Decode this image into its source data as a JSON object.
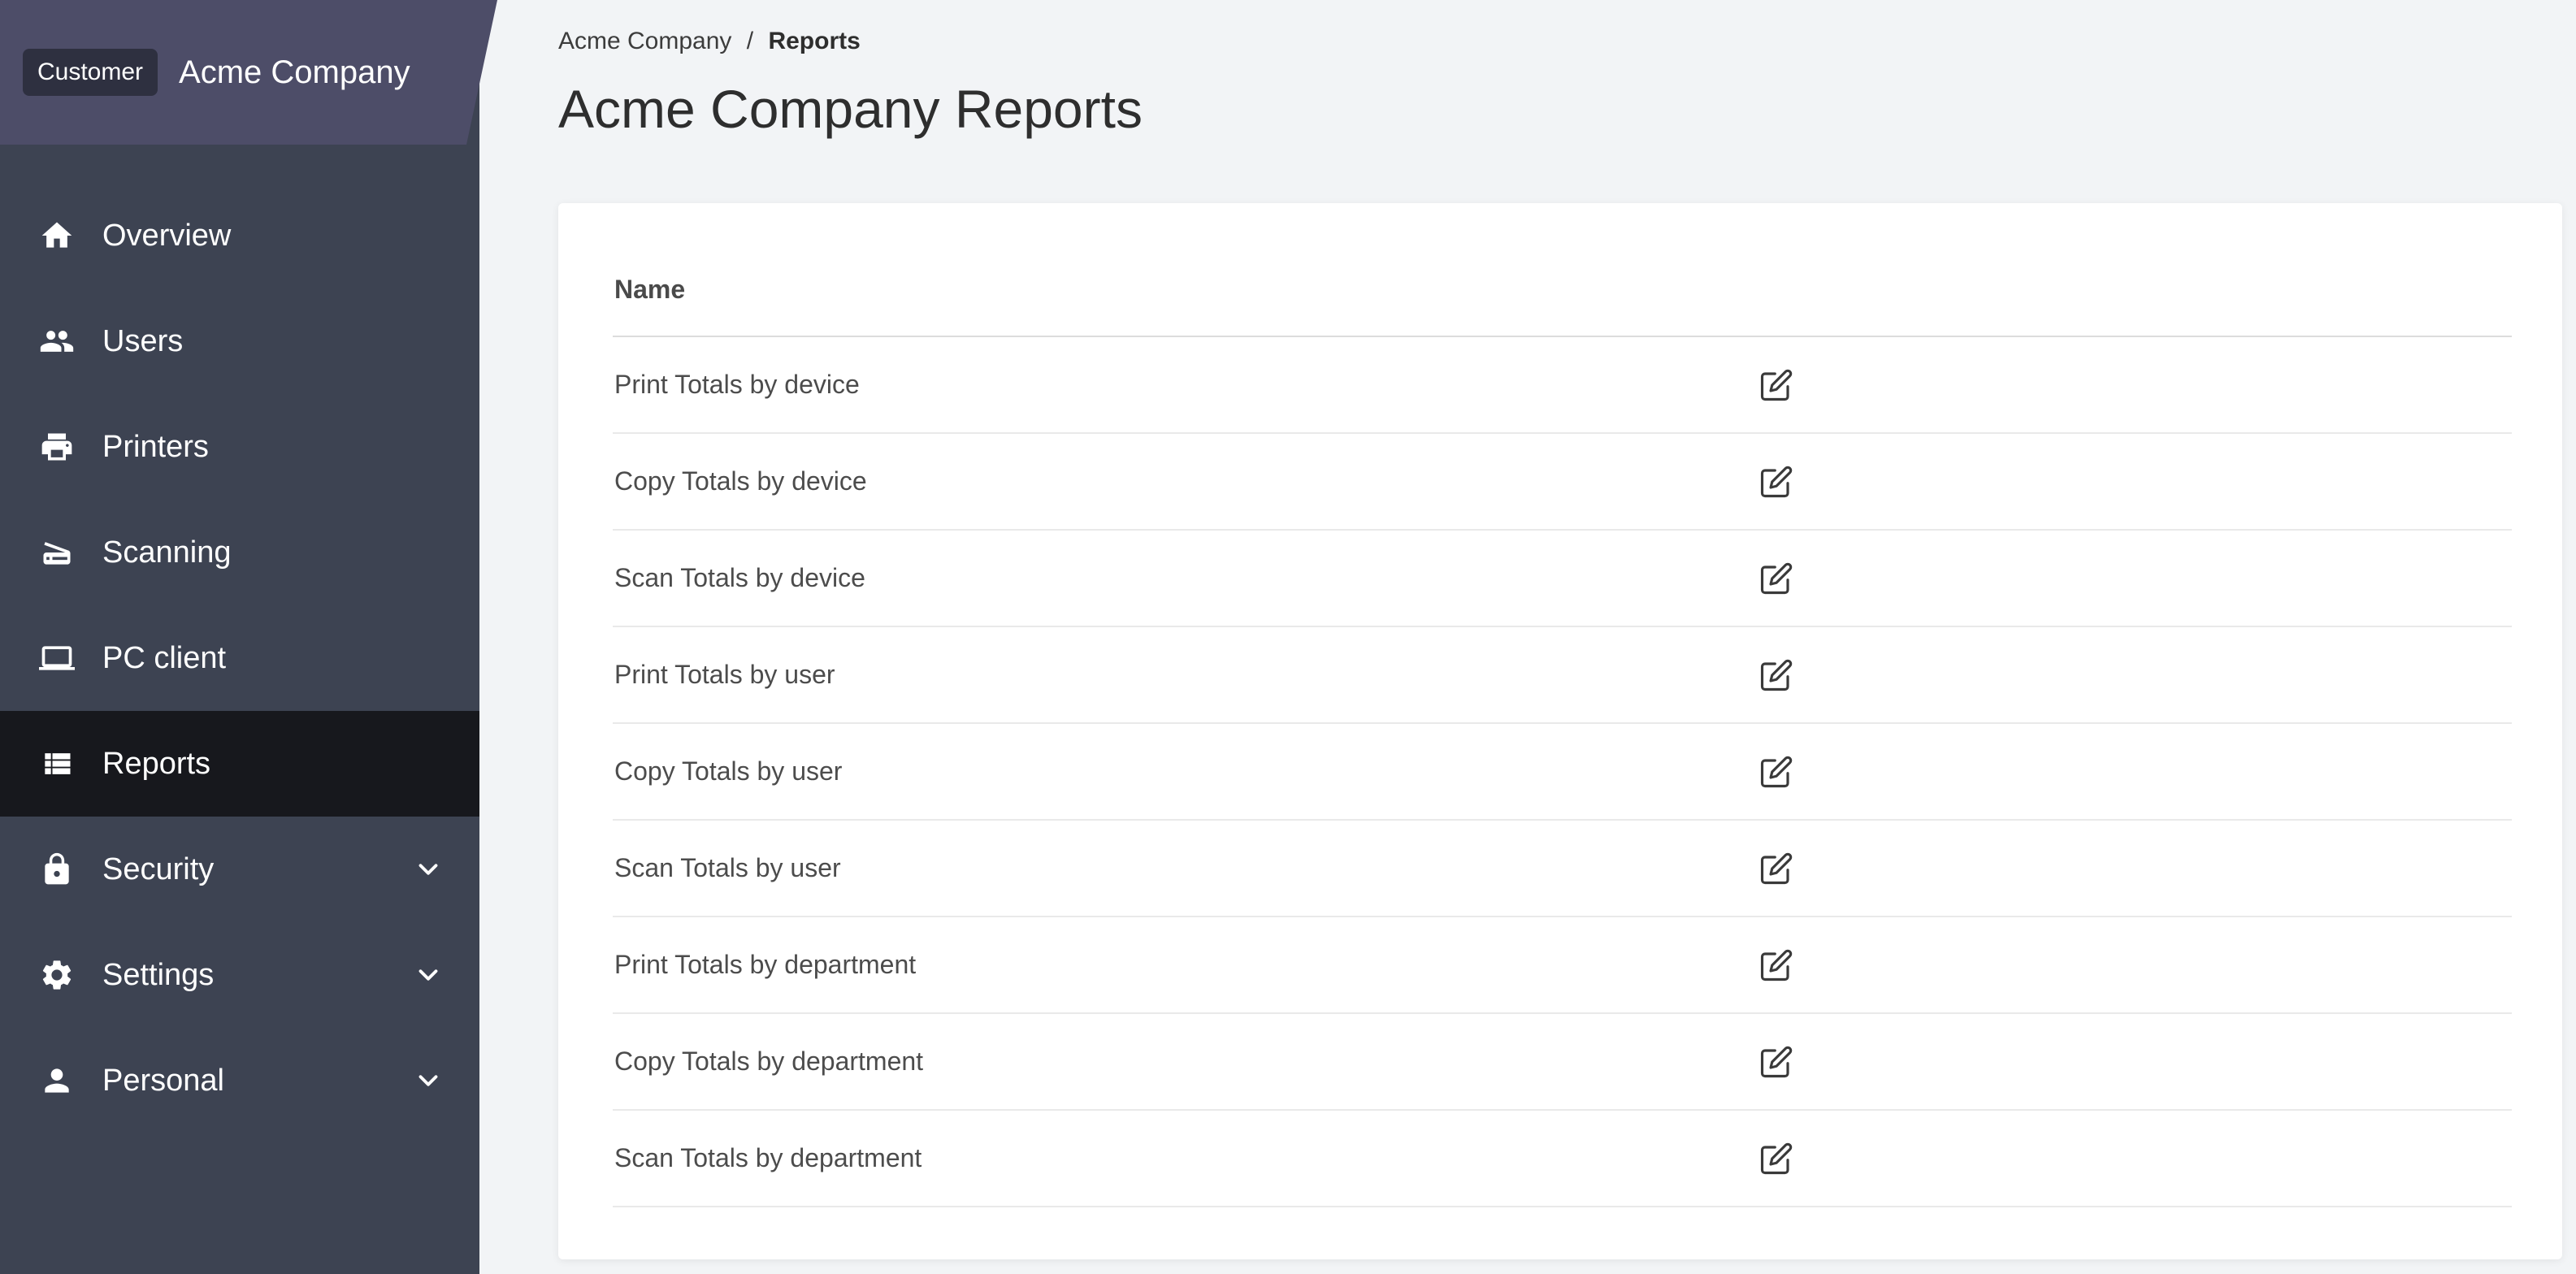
{
  "sidebar": {
    "customer_badge": "Customer",
    "customer_name": "Acme Company",
    "items": [
      {
        "label": "Overview",
        "icon": "home-icon",
        "active": false,
        "expandable": false
      },
      {
        "label": "Users",
        "icon": "users-icon",
        "active": false,
        "expandable": false
      },
      {
        "label": "Printers",
        "icon": "printer-icon",
        "active": false,
        "expandable": false
      },
      {
        "label": "Scanning",
        "icon": "scanner-icon",
        "active": false,
        "expandable": false
      },
      {
        "label": "PC client",
        "icon": "monitor-icon",
        "active": false,
        "expandable": false
      },
      {
        "label": "Reports",
        "icon": "table-icon",
        "active": true,
        "expandable": false
      },
      {
        "label": "Security",
        "icon": "lock-icon",
        "active": false,
        "expandable": true
      },
      {
        "label": "Settings",
        "icon": "gear-icon",
        "active": false,
        "expandable": true
      },
      {
        "label": "Personal",
        "icon": "person-icon",
        "active": false,
        "expandable": true
      }
    ]
  },
  "breadcrumb": {
    "parent": "Acme Company",
    "separator": "/",
    "current": "Reports"
  },
  "page": {
    "title": "Acme Company Reports"
  },
  "table": {
    "name_header": "Name",
    "action_icon": "edit-icon",
    "rows": [
      "Print Totals by device",
      "Copy Totals by device",
      "Scan Totals by device",
      "Print Totals by user",
      "Copy Totals by user",
      "Scan Totals by user",
      "Print Totals by department",
      "Copy Totals by department",
      "Scan Totals by department"
    ]
  },
  "colors": {
    "sidebar_bg": "#3d4352",
    "sidebar_header_bg": "#4d4d68",
    "active_item_bg": "#17181d",
    "badge_bg": "#2e3040",
    "main_bg": "#f2f4f6",
    "card_bg": "#ffffff"
  }
}
